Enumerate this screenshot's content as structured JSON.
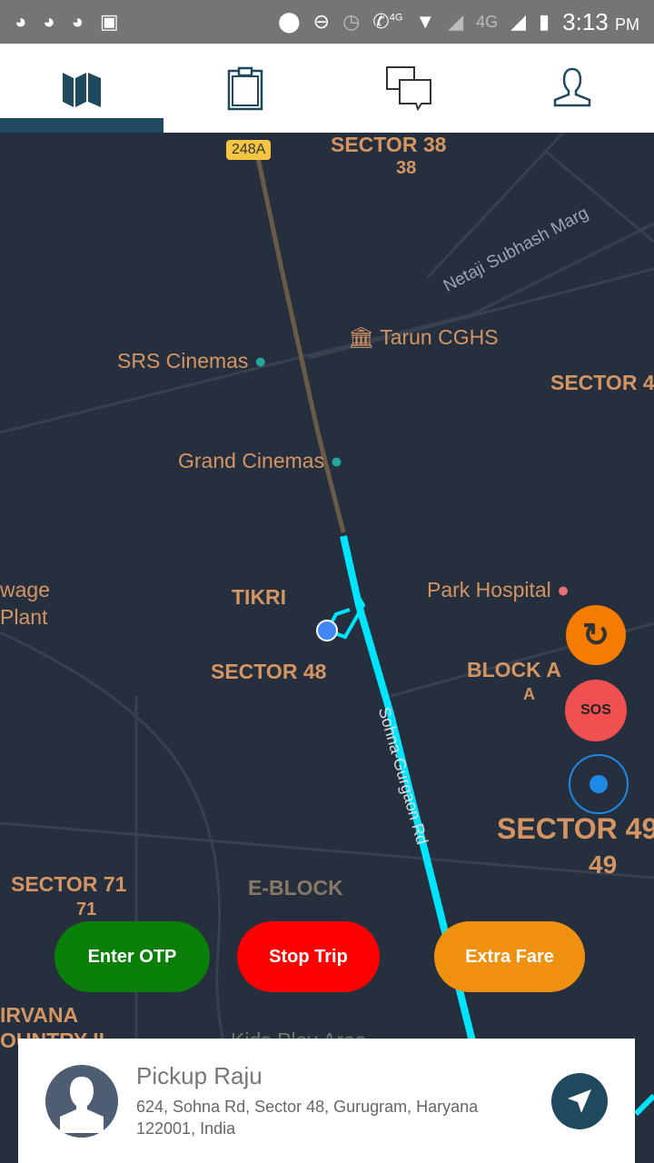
{
  "status_bar": {
    "time": "3:13",
    "ampm": "PM",
    "network": "4G",
    "network2": "4G"
  },
  "tabs": [
    {
      "icon": "map-icon",
      "active": true
    },
    {
      "icon": "clipboard-icon"
    },
    {
      "icon": "chat-icon"
    },
    {
      "icon": "profile-icon"
    }
  ],
  "map": {
    "highway_shield": "248A",
    "labels": {
      "sector38": "SECTOR 38",
      "s38": "38",
      "netaji": "Netaji Subhash Marg",
      "tarun": "Tarun CGHS",
      "srs": "SRS Cinemas",
      "sector4x": "SECTOR 4",
      "grand": "Grand Cinemas",
      "sewage1": "wage",
      "sewage2": "Plant",
      "tikri": "TIKRI",
      "park": "Park Hospital",
      "sector48": "SECTOR 48",
      "blocka": "BLOCK A",
      "a": "A",
      "sohna": "Sohna-Gurgaon Rd",
      "sector49": "SECTOR 49",
      "s49": "49",
      "sector71": "SECTOR 71",
      "s71": "71",
      "eblock": "E-BLOCK",
      "nirvana": "IRVANA",
      "country": "OUNTRY II",
      "kids": "Kids Play Area"
    },
    "colors": {
      "route": "#00e5ff",
      "label": "#d59563",
      "background": "#252f3d"
    }
  },
  "controls": {
    "sos_label": "SOS"
  },
  "actions": {
    "enter_otp": "Enter OTP",
    "stop_trip": "Stop Trip",
    "extra_fare": "Extra Fare",
    "colors": {
      "enter_otp": "#0a7f0a",
      "stop_trip": "#ff0000",
      "extra_fare": "#f0900f"
    }
  },
  "pickup": {
    "title": "Pickup Raju",
    "address_line1": "624, Sohna Rd, Sector 48, Gurugram, Haryana",
    "address_line2": "122001, India"
  }
}
